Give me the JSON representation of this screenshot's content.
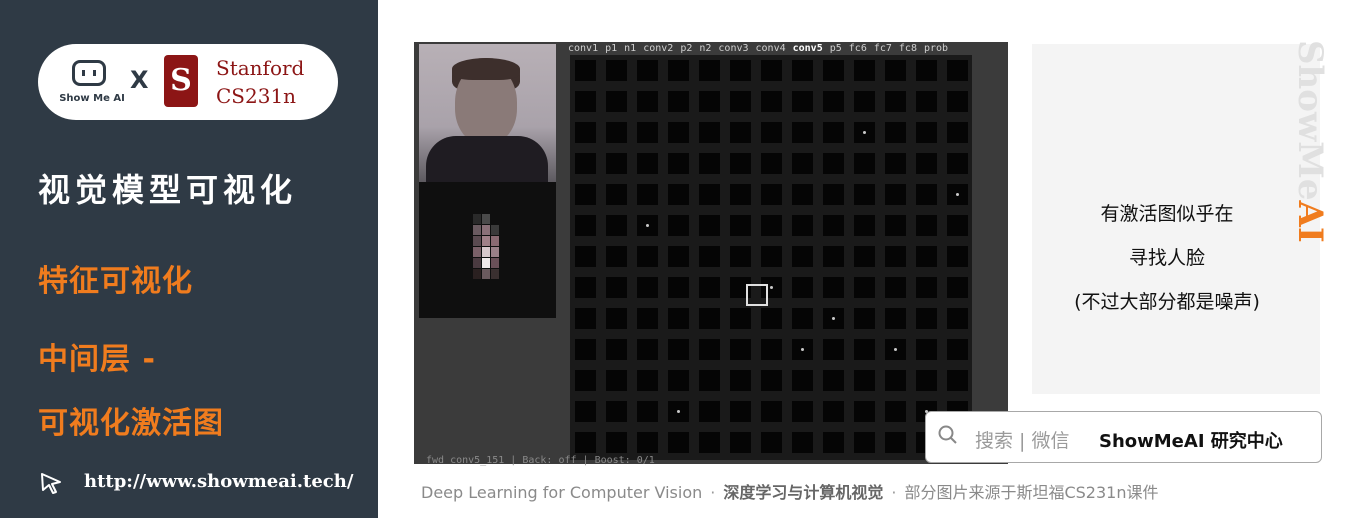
{
  "sidebar": {
    "logo": {
      "brand": "Show Me AI",
      "cross": "X",
      "partner_badge": "S",
      "partner_line1": "Stanford",
      "partner_line2": "CS231n"
    },
    "title": "视觉模型可视化",
    "section": "特征可视化",
    "subsection_line1": "中间层 -",
    "subsection_line2": "可视化激活图",
    "url": "http://www.showmeai.tech/"
  },
  "toolbox": {
    "layers": [
      "conv1",
      "p1",
      "n1",
      "conv2",
      "p2",
      "n2",
      "conv3",
      "conv4",
      "conv5",
      "p5",
      "fc6",
      "fc7",
      "fc8",
      "prob"
    ],
    "active_layer": "conv5",
    "status": "fwd conv5_151 | Back: off | Boost: 0/1"
  },
  "note": {
    "line1": "有激活图似乎在",
    "line2": "寻找人脸",
    "line3": "(不过大部分都是噪声)"
  },
  "watermark": {
    "main": "ShowMe",
    "accent": "AI"
  },
  "search": {
    "label": "搜索 | 微信",
    "brand": "ShowMeAI 研究中心"
  },
  "footer": {
    "part1": "Deep Learning for Computer Vision",
    "sep1": "·",
    "part2": "深度学习与计算机视觉",
    "sep2": "·",
    "part3": "部分图片来源于斯坦福CS231n课件"
  },
  "colors": {
    "sidebar_bg": "#2f3a45",
    "accent": "#f07c1e",
    "stanford": "#8c1515"
  },
  "icons": [
    "robot-logo-icon",
    "stanford-logo-icon",
    "cursor-click-icon",
    "search-icon"
  ]
}
